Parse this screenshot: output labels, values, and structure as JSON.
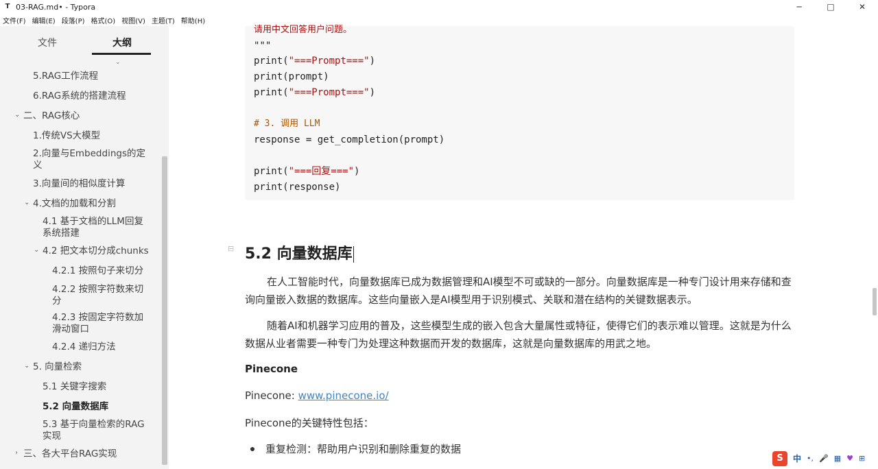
{
  "window": {
    "title": "03-RAG.md• - Typora",
    "app_icon": "T",
    "minimize": "─",
    "maximize": "□",
    "close": "✕"
  },
  "menu": [
    "文件(F)",
    "编辑(E)",
    "段落(P)",
    "格式(O)",
    "视图(V)",
    "主题(T)",
    "帮助(H)"
  ],
  "sidebar": {
    "tab_files": "文件",
    "tab_outline": "大纲",
    "outline": [
      {
        "label": "5.RAG工作流程",
        "level": 2
      },
      {
        "label": "6.RAG系统的搭建流程",
        "level": 2
      },
      {
        "label": "二、RAG核心",
        "level": 1,
        "expanded": true
      },
      {
        "label": "1.传统VS大模型",
        "level": 2
      },
      {
        "label": "2.向量与Embeddings的定义",
        "level": 2
      },
      {
        "label": "3.向量间的相似度计算",
        "level": 2
      },
      {
        "label": "4.文档的加载和分割",
        "level": 2,
        "expanded": true
      },
      {
        "label": "4.1 基于文档的LLM回复系统搭建",
        "level": 3
      },
      {
        "label": "4.2 把文本切分成chunks",
        "level": 3,
        "expanded": true
      },
      {
        "label": "4.2.1 按照句子来切分",
        "level": 4
      },
      {
        "label": "4.2.2 按照字符数来切分",
        "level": 4
      },
      {
        "label": "4.2.3 按固定字符数加滑动窗口",
        "level": 4
      },
      {
        "label": "4.2.4 递归方法",
        "level": 4
      },
      {
        "label": "5. 向量检索",
        "level": 2,
        "expanded": true
      },
      {
        "label": "5.1 关键字搜索",
        "level": 3
      },
      {
        "label": "5.2 向量数据库",
        "level": 3,
        "active": true
      },
      {
        "label": "5.3 基于向量检索的RAG实现",
        "level": 3
      },
      {
        "label": "三、各大平台RAG实现",
        "level": 1,
        "expanded": false
      }
    ],
    "bottom_left": "‹",
    "bottom_code": "</>"
  },
  "editor": {
    "code": {
      "line1": "请用中文回答用户问题。",
      "line2": "\"\"\"",
      "line3_fn": "print",
      "line3_arg": "\"===Prompt===\"",
      "line4": "print(prompt)",
      "line5_fn": "print",
      "line5_arg": "\"===Prompt===\"",
      "line6": "# 3. 调用 LLM",
      "line7": "response = get_completion(prompt)",
      "line8_fn": "print",
      "line8_arg": "\"===回复===\"",
      "line9": "print(response)"
    },
    "heading": "5.2 向量数据库",
    "para1": "在人工智能时代，向量数据库已成为数据管理和AI模型不可或缺的一部分。向量数据库是一种专门设计用来存储和查询向量嵌入数据的数据库。这些向量嵌入是AI模型用于识别模式、关联和潜在结构的关键数据表示。",
    "para2": "随着AI和机器学习应用的普及，这些模型生成的嵌入包含大量属性或特征，使得它们的表示难以管理。这就是为什么数据从业者需要一种专门为处理这种数据而开发的数据库，这就是向量数据库的用武之地。",
    "pinecone_title": "Pinecone",
    "pinecone_prefix": "Pinecone: ",
    "pinecone_link": "www.pinecone.io/",
    "pinecone_features": "Pinecone的关键特性包括：",
    "bullet1": "重复检测：帮助用户识别和删除重复的数据"
  },
  "ime": {
    "logo": "S",
    "mode": "中",
    "punct": "•,",
    "mic": "🎤",
    "icons": [
      "▦",
      "♥",
      "⊞"
    ]
  }
}
